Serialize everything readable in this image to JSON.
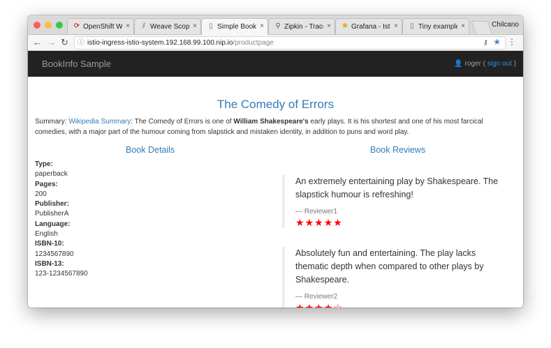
{
  "browser": {
    "tabs": [
      {
        "title": "OpenShift Web",
        "icon": "openshift-icon",
        "icon_color": "#cc0000"
      },
      {
        "title": "Weave Scope",
        "icon": "weave-scope-icon",
        "icon_color": "#2c6ea8"
      },
      {
        "title": "Simple Bookst",
        "icon": "document-icon",
        "icon_color": "#666666",
        "active": true
      },
      {
        "title": "Zipkin - Trace",
        "icon": "zipkin-icon",
        "icon_color": "#555555"
      },
      {
        "title": "Grafana - Istic",
        "icon": "grafana-icon",
        "icon_color": "#f2a023"
      },
      {
        "title": "Tiny example",
        "icon": "document-icon",
        "icon_color": "#666666"
      }
    ],
    "close_glyph": "×",
    "profile_name": "Chilcano",
    "url_host": "istio-ingress-istio-system.192.168.99.100.nip.io",
    "url_path": "/productpage"
  },
  "app": {
    "brand": "BookInfo Sample",
    "user": "roger (",
    "signout": "sign out",
    "user_suffix": ")"
  },
  "book": {
    "title": "The Comedy of Errors",
    "summary_prefix": "Summary: ",
    "summary_link": "Wikipedia Summary",
    "summary_mid": ": The Comedy of Errors is one of ",
    "summary_bold": "William Shakespeare's",
    "summary_rest": " early plays. It is his shortest and one of his most farcical comedies, with a major part of the humour coming from slapstick and mistaken identity, in addition to puns and word play."
  },
  "details": {
    "heading": "Book Details",
    "fields": [
      {
        "label": "Type:",
        "value": "paperback"
      },
      {
        "label": "Pages:",
        "value": "200"
      },
      {
        "label": "Publisher:",
        "value": "PublisherA"
      },
      {
        "label": "Language:",
        "value": "English"
      },
      {
        "label": "ISBN-10:",
        "value": "1234567890"
      },
      {
        "label": "ISBN-13:",
        "value": "123-1234567890"
      }
    ]
  },
  "reviews": {
    "heading": "Book Reviews",
    "star_color": "#ff0000",
    "items": [
      {
        "text": "An extremely entertaining play by Shakespeare. The slapstick humour is refreshing!",
        "reviewer": "— Reviewer1",
        "rating": 5,
        "max": 5
      },
      {
        "text": "Absolutely fun and entertaining. The play lacks thematic depth when compared to other plays by Shakespeare.",
        "reviewer": "— Reviewer2",
        "rating": 4,
        "max": 5
      }
    ]
  }
}
